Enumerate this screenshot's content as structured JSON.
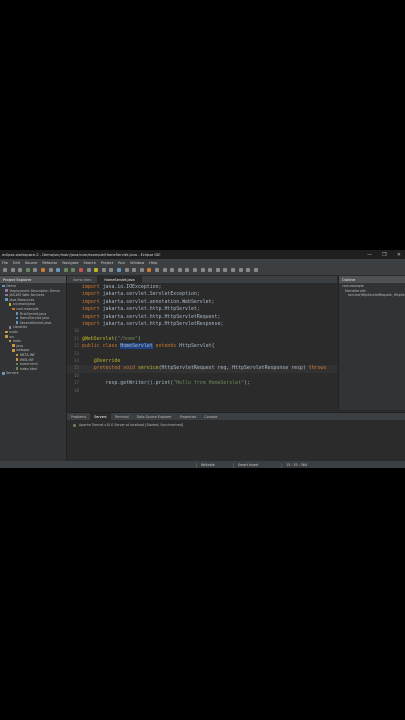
{
  "window": {
    "title": "eclipse-workspace-2 - Demo/src/main/java/com/example/HomeServlet.java - Eclipse IDE",
    "minimize": "—",
    "maximize": "❐",
    "close": "✕"
  },
  "menu": [
    "File",
    "Edit",
    "Source",
    "Refactor",
    "Navigate",
    "Search",
    "Project",
    "Run",
    "Window",
    "Help"
  ],
  "explorer": {
    "title": "Project Explorer",
    "items": [
      {
        "label": "Demo",
        "indent": 0,
        "color": "#6897bb"
      },
      {
        "label": "Deployment Descriptor: Demo",
        "indent": 1,
        "color": "#9876aa"
      },
      {
        "label": "JAX-WS Web Services",
        "indent": 1,
        "color": "#9876aa"
      },
      {
        "label": "Java Resources",
        "indent": 1,
        "color": "#6897bb"
      },
      {
        "label": "src/main/java",
        "indent": 2,
        "color": "#bbb529"
      },
      {
        "label": "com.example",
        "indent": 3,
        "color": "#cc7832"
      },
      {
        "label": "FirstServlet.java",
        "indent": 4,
        "color": "#6897bb"
      },
      {
        "label": "HomeServlet.java",
        "indent": 4,
        "color": "#6897bb"
      },
      {
        "label": "SecondServlet.java",
        "indent": 4,
        "color": "#6897bb"
      },
      {
        "label": "Libraries",
        "indent": 2,
        "color": "#9876aa"
      },
      {
        "label": "build",
        "indent": 1,
        "color": "#cc9944"
      },
      {
        "label": "src",
        "indent": 1,
        "color": "#cc9944"
      },
      {
        "label": "main",
        "indent": 2,
        "color": "#cc9944"
      },
      {
        "label": "java",
        "indent": 3,
        "color": "#cc9944"
      },
      {
        "label": "webapp",
        "indent": 3,
        "color": "#cc9944"
      },
      {
        "label": "META-INF",
        "indent": 4,
        "color": "#cc9944"
      },
      {
        "label": "WEB-INF",
        "indent": 4,
        "color": "#cc9944"
      },
      {
        "label": "home.html",
        "indent": 4,
        "color": "#6a8759"
      },
      {
        "label": "index.html",
        "indent": 4,
        "color": "#6a8759"
      },
      {
        "label": "Servers",
        "indent": 0,
        "color": "#6897bb"
      }
    ]
  },
  "editor": {
    "tabs": [
      {
        "label": "home.html",
        "active": false
      },
      {
        "label": "HomeServlet.java",
        "active": true
      }
    ],
    "lines": [
      {
        "n": "",
        "html": ""
      },
      {
        "n": "",
        "html": "<span class='kw'>import</span> java.io.IOException;"
      },
      {
        "n": "",
        "html": ""
      },
      {
        "n": "",
        "html": "<span class='kw'>import</span> jakarta.servlet.ServletException;"
      },
      {
        "n": "",
        "html": "<span class='kw'>import</span> jakarta.servlet.annotation.WebServlet;"
      },
      {
        "n": "",
        "html": "<span class='kw'>import</span> jakarta.servlet.http.HttpServlet;"
      },
      {
        "n": "",
        "html": "<span class='kw'>import</span> jakarta.servlet.http.HttpServletRequest;"
      },
      {
        "n": "",
        "html": "<span class='kw'>import</span> jakarta.servlet.http.HttpServletResponse;"
      },
      {
        "n": "10",
        "html": ""
      },
      {
        "n": "11",
        "html": "<span class='an'>@WebServlet</span>(<span class='st'>\"/home\"</span>)"
      },
      {
        "n": "12",
        "html": "<span class='kw'>public class</span> <span class='hl'>HomeServlet</span> <span class='kw'>extends</span> HttpServlet{"
      },
      {
        "n": "13",
        "html": ""
      },
      {
        "n": "14",
        "html": "    <span class='an'>@Override</span>"
      },
      {
        "n": "15",
        "html": "    <span class='kw'>protected void</span> <span class='an'>service</span>(HttpServletRequest req, HttpServletResponse resp) <span class='kw'>throws</span>"
      },
      {
        "n": "16",
        "html": ""
      },
      {
        "n": "17",
        "html": "        resp.getWriter().print(<span class='st'>\"Hello from HomeServlet\"</span>);"
      },
      {
        "n": "18",
        "html": ""
      }
    ]
  },
  "outline": {
    "title": "Outline",
    "items": [
      {
        "label": "com.example",
        "indent": 0
      },
      {
        "label": "HomeServlet",
        "indent": 1
      },
      {
        "label": "service(HttpServletRequest, HttpServlet",
        "indent": 2
      }
    ]
  },
  "bottom": {
    "tabs": [
      {
        "label": "Problems",
        "active": false
      },
      {
        "label": "Servers",
        "active": true
      },
      {
        "label": "Terminal",
        "active": false
      },
      {
        "label": "Data Source Explorer",
        "active": false
      },
      {
        "label": "Properties",
        "active": false
      },
      {
        "label": "Console",
        "active": false
      }
    ],
    "server": "Apache Tomcat v10.0 Server at localhost  [Started, Synchronized]"
  },
  "status": {
    "writable": "Writable",
    "insert": "Smart Insert",
    "position": "15 : 35 : 364"
  }
}
